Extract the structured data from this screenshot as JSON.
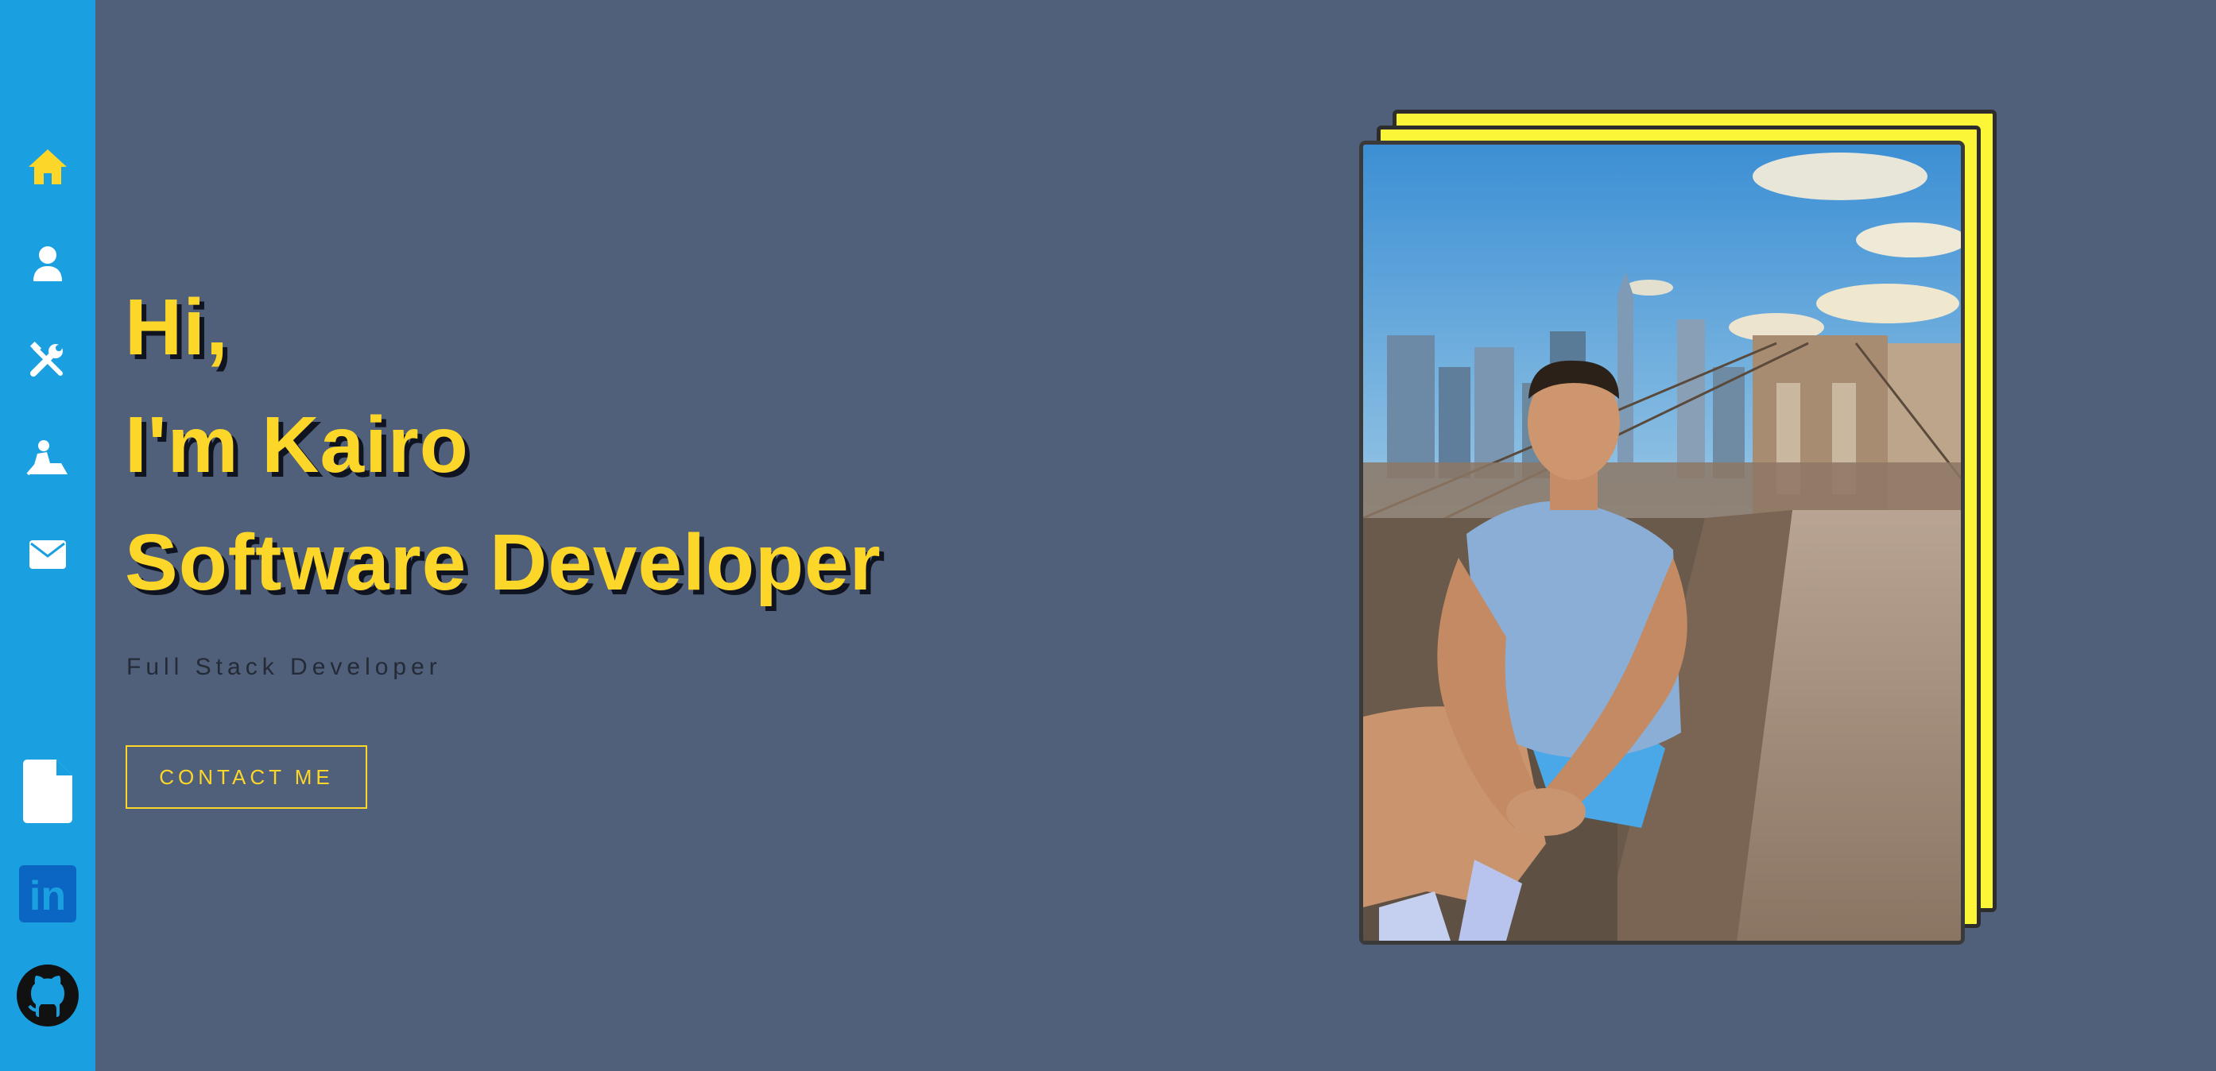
{
  "nav": {
    "items": [
      {
        "name": "home",
        "icon": "home-icon",
        "color": "#fcd629"
      },
      {
        "name": "about",
        "icon": "user-icon",
        "color": "#ffffff"
      },
      {
        "name": "skills",
        "icon": "tools-icon",
        "color": "#ffffff"
      },
      {
        "name": "projects",
        "icon": "worker-icon",
        "color": "#ffffff"
      },
      {
        "name": "contact",
        "icon": "envelope-icon",
        "color": "#ffffff"
      }
    ],
    "bottom": [
      {
        "name": "resume",
        "icon": "file-icon"
      },
      {
        "name": "linkedin",
        "icon": "linkedin-icon",
        "logo_text": "in"
      },
      {
        "name": "github",
        "icon": "github-icon"
      }
    ]
  },
  "hero": {
    "line1": "Hi,",
    "line2": "I'm Kairo",
    "line3": "Software Developer",
    "subtitle": "Full Stack Developer",
    "cta_label": "CONTACT ME"
  },
  "profile_photo": {
    "alt": "Man sitting on Brooklyn Bridge with city skyline"
  },
  "colors": {
    "background": "#505f7a",
    "sidebar": "#1aa0e0",
    "accent": "#fcd629",
    "card": "#fbf637"
  }
}
